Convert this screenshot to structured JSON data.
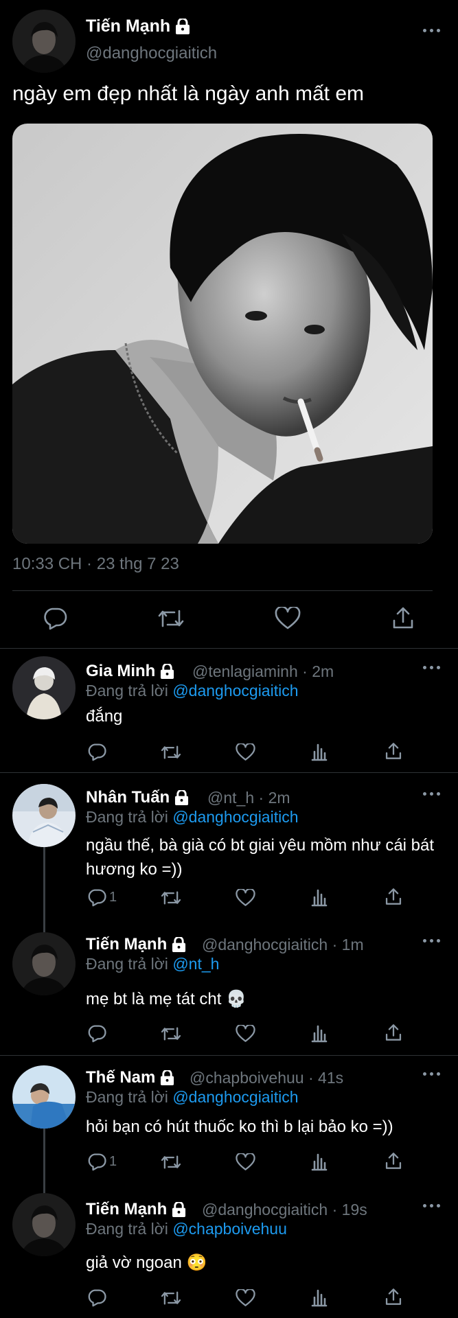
{
  "main_tweet": {
    "name": "Tiến Mạnh",
    "handle": "@danghocgiaitich",
    "text": "ngày em đẹp nhất là ngày anh mất em",
    "timestamp": "10:33 CH · 23 thg 7 23",
    "image_description_icon": "photo"
  },
  "replies": [
    {
      "name": "Gia Minh",
      "handle": "@tenlagiaminh",
      "time": "2m",
      "replying_label": "Đang trả lời",
      "replying_to": "@danghocgiaitich",
      "text": "đắng",
      "reply_count": ""
    },
    {
      "name": "Nhân Tuấn",
      "handle": "@nt_h",
      "time": "2m",
      "replying_label": "Đang trả lời",
      "replying_to": "@danghocgiaitich",
      "text": "ngầu thế, bà già có bt giai yêu mồm như cái bát hương ko =))",
      "reply_count": "1"
    },
    {
      "name": "Tiến Mạnh",
      "handle": "@danghocgiaitich",
      "time": "1m",
      "replying_label": "Đang trả lời",
      "replying_to": "@nt_h",
      "text": "mẹ bt là mẹ tát cht 💀",
      "reply_count": ""
    },
    {
      "name": "Thế Nam",
      "handle": "@chapboivehuu",
      "time": "41s",
      "replying_label": "Đang trả lời",
      "replying_to": "@danghocgiaitich",
      "text": "hỏi bạn có hút thuốc ko thì b lại bảo ko =))",
      "reply_count": "1"
    },
    {
      "name": "Tiến Mạnh",
      "handle": "@danghocgiaitich",
      "time": "19s",
      "replying_label": "Đang trả lời",
      "replying_to": "@chapboivehuu",
      "text": "giả vờ ngoan 😳",
      "reply_count": ""
    }
  ],
  "dot_separator": "·",
  "colors": {
    "background": "#000000",
    "muted": "#6e767d",
    "link": "#1d9bf0",
    "divider": "#2f3336"
  }
}
